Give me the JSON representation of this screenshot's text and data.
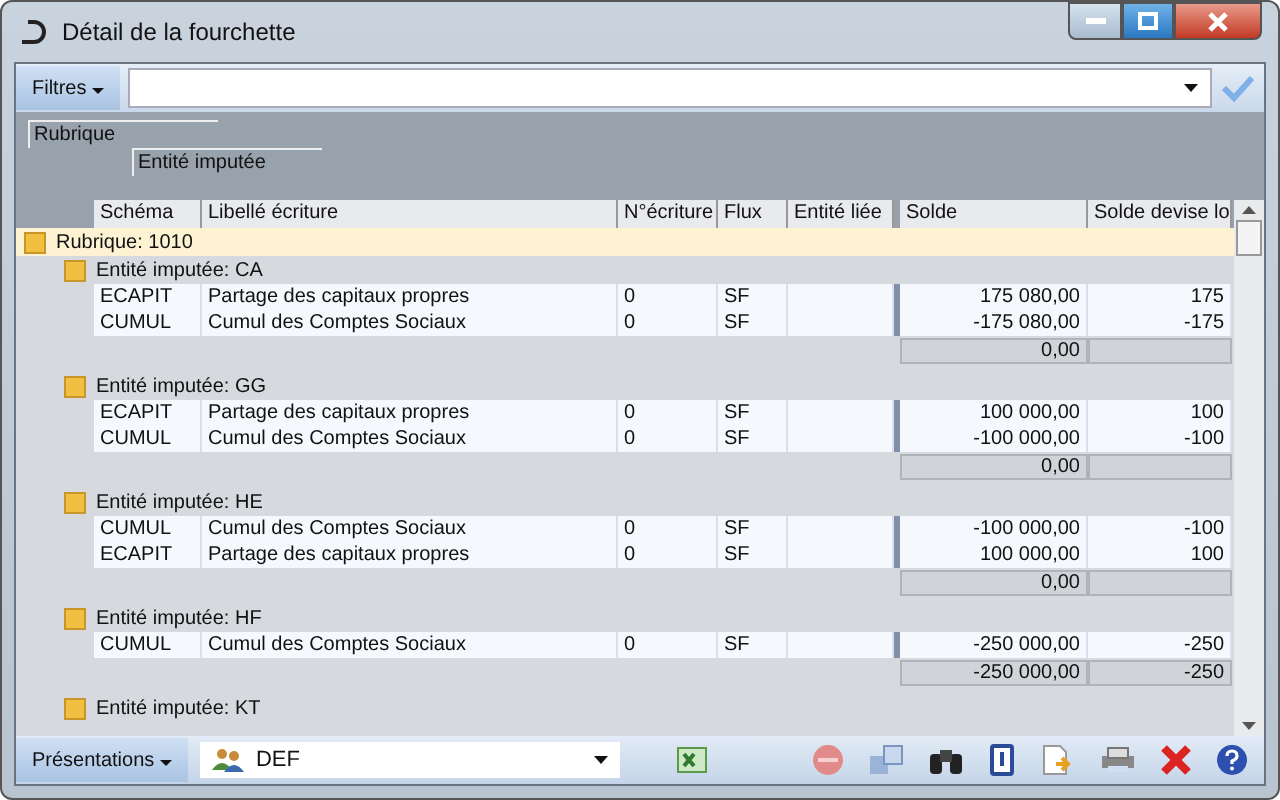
{
  "window": {
    "title": "Détail de la fourchette"
  },
  "filter_bar": {
    "menu": "Filtres"
  },
  "grouping": [
    {
      "label": "Rubrique"
    },
    {
      "label": "Entité imputée"
    }
  ],
  "table": {
    "columns": [
      "Schéma",
      "Libellé écriture",
      "N°écriture",
      "Flux",
      "Entité liée",
      "Solde",
      "Solde devise lo"
    ],
    "rubrique": "Rubrique: 1010",
    "groups": [
      {
        "label": "Entité imputée: CA",
        "rows": [
          {
            "schema": "ECAPIT",
            "libelle": "Partage des capitaux propres",
            "numero": "0",
            "flux": "SF",
            "solde": "175 080,00",
            "devise": "175"
          },
          {
            "schema": "CUMUL",
            "libelle": "Cumul des Comptes Sociaux",
            "numero": "0",
            "flux": "SF",
            "solde": "-175 080,00",
            "devise": "-175"
          }
        ],
        "total": {
          "solde": "0,00"
        }
      },
      {
        "label": "Entité imputée: GG",
        "rows": [
          {
            "schema": "ECAPIT",
            "libelle": "Partage des capitaux propres",
            "numero": "0",
            "flux": "SF",
            "solde": "100 000,00",
            "devise": "100"
          },
          {
            "schema": "CUMUL",
            "libelle": "Cumul des Comptes Sociaux",
            "numero": "0",
            "flux": "SF",
            "solde": "-100 000,00",
            "devise": "-100"
          }
        ],
        "total": {
          "solde": "0,00"
        }
      },
      {
        "label": "Entité imputée: HE",
        "rows": [
          {
            "schema": "CUMUL",
            "libelle": "Cumul des Comptes Sociaux",
            "numero": "0",
            "flux": "SF",
            "solde": "-100 000,00",
            "devise": "-100"
          },
          {
            "schema": "ECAPIT",
            "libelle": "Partage des capitaux propres",
            "numero": "0",
            "flux": "SF",
            "solde": "100 000,00",
            "devise": "100"
          }
        ],
        "total": {
          "solde": "0,00"
        }
      },
      {
        "label": "Entité imputée: HF",
        "rows": [
          {
            "schema": "CUMUL",
            "libelle": "Cumul des Comptes Sociaux",
            "numero": "0",
            "flux": "SF",
            "solde": "-250 000,00",
            "devise": "-250"
          }
        ],
        "total": {
          "solde": "-250 000,00",
          "devise": "-250"
        }
      },
      {
        "label": "Entité imputée: KT"
      }
    ]
  },
  "bottom_bar": {
    "menu": "Présentations",
    "presentation": "DEF"
  }
}
